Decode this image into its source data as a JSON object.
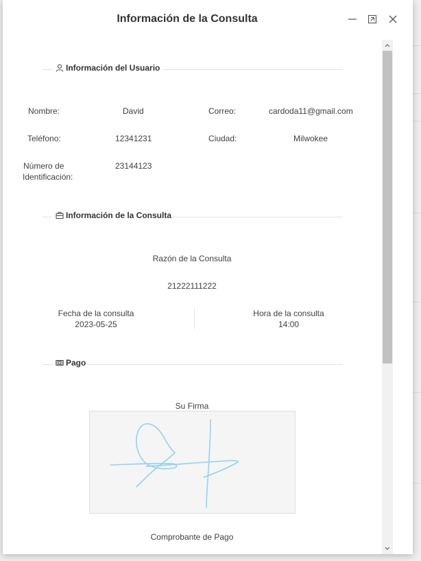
{
  "dialog": {
    "title": "Información de la Consulta"
  },
  "user_section": {
    "title": "Información del Usuario",
    "name_label": "Nombre:",
    "name_value": "David",
    "email_label": "Correo:",
    "email_value": "cardoda11@gmail.com",
    "phone_label": "Teléfono:",
    "phone_value": "12341231",
    "city_label": "Ciudad:",
    "city_value": "Milwokee",
    "id_label_line1": "Número de",
    "id_label_line2": "Identificación:",
    "id_value": "23144123"
  },
  "consult_section": {
    "title": "Información de la Consulta",
    "reason_label": "Razón de la Consulta",
    "reason_value": "21222111222",
    "date_label": "Fecha de la consulta",
    "date_value": "2023-05-25",
    "time_label": "Hora de la consulta",
    "time_value": "14:00"
  },
  "payment_section": {
    "title": "Pago",
    "signature_label": "Su Firma",
    "receipt_label": "Comprobante de Pago"
  },
  "icons": {
    "minimize": "minimize-icon",
    "maximize": "maximize-icon",
    "close": "close-icon",
    "user": "user-icon",
    "briefcase": "briefcase-icon",
    "money": "money-icon"
  },
  "colors": {
    "signature_stroke": "#8fd3f0"
  }
}
